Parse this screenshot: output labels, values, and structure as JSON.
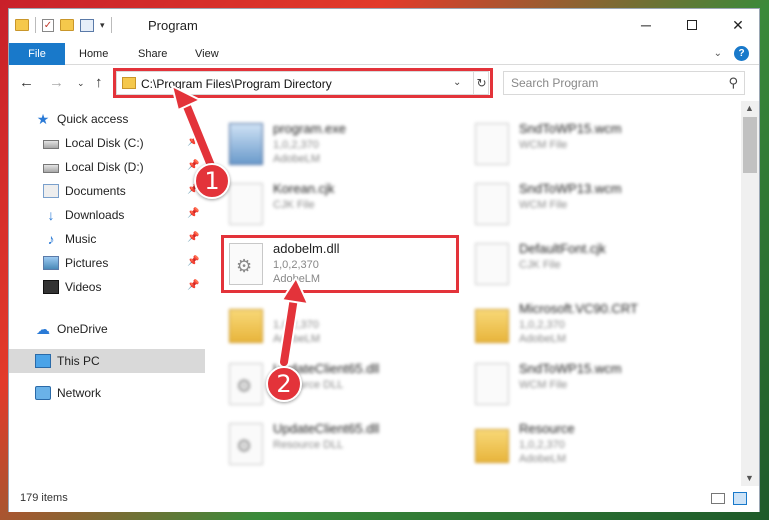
{
  "window": {
    "title": "Program",
    "minimize_symbol": "─",
    "close_symbol": "✕"
  },
  "quick_access_toolbar": {
    "check_symbol": "✓",
    "dropdown_symbol": "▾"
  },
  "ribbon": {
    "tabs": [
      "File",
      "Home",
      "Share",
      "View"
    ],
    "expand_symbol": "⌄",
    "help_symbol": "?"
  },
  "navigation": {
    "back_symbol": "←",
    "forward_symbol": "→",
    "recent_symbol": "⌄",
    "up_symbol": "↑",
    "address": "C:\\Program Files\\Program Directory",
    "address_dropdown_symbol": "⌄",
    "refresh_symbol": "↻",
    "search_placeholder": "Search Program",
    "search_symbol": "⚲"
  },
  "sidebar": {
    "pin_symbol": "📌",
    "items": [
      {
        "label": "Quick access",
        "icon": "star-icon",
        "pinned": false
      },
      {
        "label": "Local Disk (C:)",
        "icon": "drive-icon",
        "pinned": true
      },
      {
        "label": "Local Disk (D:)",
        "icon": "drive-icon",
        "pinned": true
      },
      {
        "label": "Documents",
        "icon": "documents-icon",
        "pinned": true
      },
      {
        "label": "Downloads",
        "icon": "download-arrow-icon",
        "pinned": true
      },
      {
        "label": "Music",
        "icon": "music-note-icon",
        "pinned": true
      },
      {
        "label": "Pictures",
        "icon": "pictures-icon",
        "pinned": true
      },
      {
        "label": "Videos",
        "icon": "film-icon",
        "pinned": true
      },
      {
        "label": "OneDrive",
        "icon": "cloud-icon",
        "pinned": false
      },
      {
        "label": "This PC",
        "icon": "monitor-icon",
        "pinned": false,
        "selected": true
      },
      {
        "label": "Network",
        "icon": "network-icon",
        "pinned": false
      }
    ]
  },
  "files": [
    {
      "name": "program.exe",
      "line1": "1,0,2,370",
      "line2": "AdobeLM",
      "icon": "exe-icon"
    },
    {
      "name": "SndToWP15.wcm",
      "line1": "WCM File",
      "line2": "",
      "icon": "document-icon"
    },
    {
      "name": "Korean.cjk",
      "line1": "CJK File",
      "line2": "",
      "icon": "document-icon"
    },
    {
      "name": "SndToWP13.wcm",
      "line1": "WCM File",
      "line2": "",
      "icon": "document-icon"
    },
    {
      "name": "adobelm.dll",
      "line1": "1,0,2,370",
      "line2": "AdobeLM",
      "icon": "dll-gear-icon",
      "highlighted": true
    },
    {
      "name": "DefaultFont.cjk",
      "line1": "CJK File",
      "line2": "",
      "icon": "document-icon"
    },
    {
      "name": "",
      "line1": "1,0,2,370",
      "line2": "AdobeLM",
      "icon": "folder-icon"
    },
    {
      "name": "Microsoft.VC90.CRT",
      "line1": "1,0,2,370",
      "line2": "AdobeLM",
      "icon": "folder-icon"
    },
    {
      "name": "UpdateClient65.dll",
      "line1": "Resource DLL",
      "line2": "",
      "icon": "dll-gear-icon"
    },
    {
      "name": "SndToWP15.wcm",
      "line1": "WCM File",
      "line2": "",
      "icon": "document-icon"
    },
    {
      "name": "UpdateClient65.dll",
      "line1": "Resource DLL",
      "line2": "",
      "icon": "dll-gear-icon"
    },
    {
      "name": "Resource",
      "line1": "1,0,2,370",
      "line2": "AdobeLM",
      "icon": "folder-icon"
    }
  ],
  "scrollbar": {
    "up_symbol": "▲",
    "down_symbol": "▼"
  },
  "status": {
    "item_count": "179 items"
  },
  "annotations": {
    "step1": "1",
    "step2": "2",
    "color": "#e3333a"
  }
}
